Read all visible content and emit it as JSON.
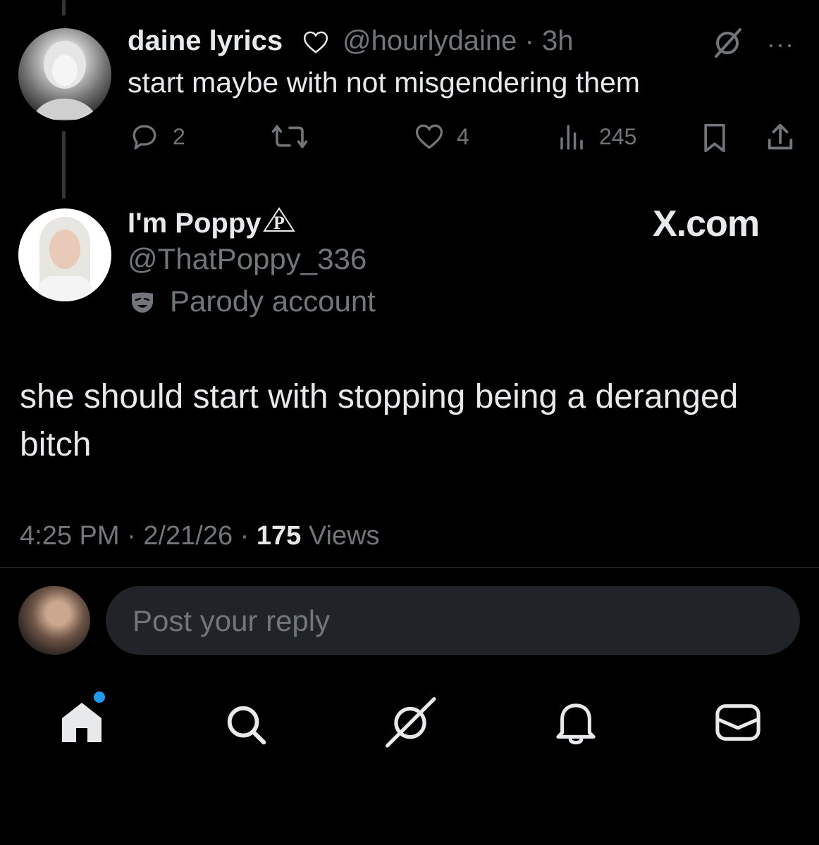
{
  "quoted_tweet": {
    "name": "daine lyrics",
    "handle": "@hourlydaine",
    "time": "3h",
    "text": "start maybe with not misgendering them",
    "replies": "2",
    "likes": "4",
    "views": "245"
  },
  "main_tweet": {
    "name": "I'm Poppy",
    "handle": "@ThatPoppy_336",
    "label": "Parody account",
    "watermark": "X.com",
    "text": "she should start with stopping being a deranged bitch",
    "time": "4:25 PM",
    "date": "2/21/26",
    "views_count": "175",
    "views_label": "Views"
  },
  "reply": {
    "placeholder": "Post your reply"
  },
  "icons": [
    "heart-outline-icon",
    "grok-icon",
    "more-icon",
    "reply-icon",
    "retweet-icon",
    "like-icon",
    "views-icon",
    "bookmark-icon",
    "share-icon",
    "parody-mask-icon",
    "home-icon",
    "search-icon",
    "grok-icon",
    "notifications-icon",
    "messages-icon"
  ],
  "colors": {
    "background": "#000000",
    "text": "#e7e9ea",
    "muted": "#71767b",
    "accent": "#1d9bf0",
    "reply_box": "#202327"
  }
}
